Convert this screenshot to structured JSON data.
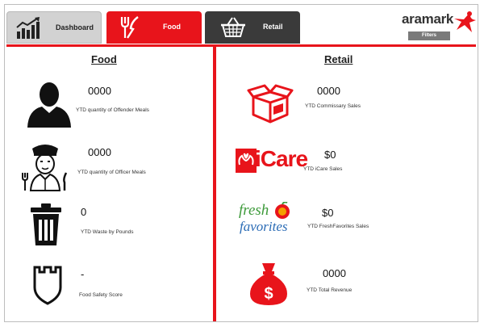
{
  "tabs": [
    {
      "label": "Dashboard",
      "icon": "bar-chart-icon"
    },
    {
      "label": "Food",
      "icon": "fork-knife-icon"
    },
    {
      "label": "Retail",
      "icon": "basket-icon"
    }
  ],
  "brand": {
    "name": "aramark",
    "filters_label": "Filters"
  },
  "colors": {
    "accent": "#e8141b",
    "dark_tab": "#3a3a3a",
    "light_tab": "#d2d2d2"
  },
  "food": {
    "title": "Food",
    "metrics": [
      {
        "value": "0000",
        "label": "YTD quantity of Offender Meals",
        "icon": "person-silhouette-icon"
      },
      {
        "value": "0000",
        "label": "YTD quantity of Officer Meals",
        "icon": "officer-icon"
      },
      {
        "value": "0",
        "label": "YTD Waste by Pounds",
        "icon": "trash-can-icon"
      },
      {
        "value": "-",
        "label": "Food Safety Score",
        "icon": "shield-icon"
      }
    ]
  },
  "retail": {
    "title": "Retail",
    "metrics": [
      {
        "value": "0000",
        "label": "YTD Commissary Sales",
        "icon": "box-icon"
      },
      {
        "value": "$0",
        "label": "YTD iCare Sales",
        "icon": "icare-logo",
        "logo_text": "iCare"
      },
      {
        "value": "$0",
        "label": "YTD FreshFavorites Sales",
        "icon": "fresh-favorites-logo",
        "logo_text_1": "fresh",
        "logo_text_2": "favorites"
      },
      {
        "value": "0000",
        "label": "YTD Total Revenue",
        "icon": "money-bag-icon"
      }
    ]
  }
}
